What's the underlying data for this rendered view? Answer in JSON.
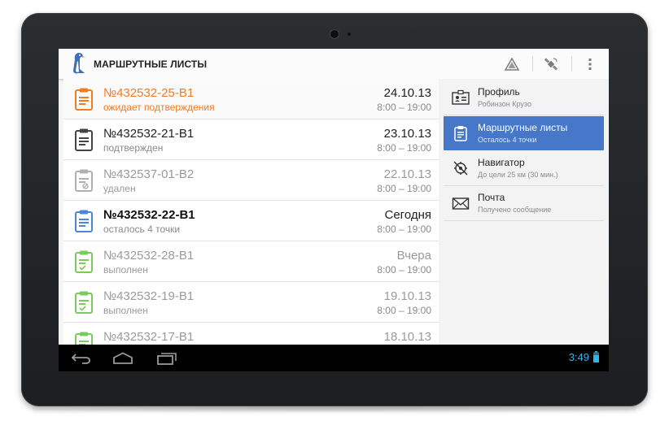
{
  "app": {
    "title": "МАРШРУТНЫЕ ЛИСТЫ",
    "logo_icon": "penguin-logo",
    "actions": [
      {
        "name": "warning-icon"
      },
      {
        "name": "gps-satellite-icon"
      },
      {
        "name": "overflow-menu-icon"
      }
    ]
  },
  "colors": {
    "orange": "#f47b20",
    "dark": "#444444",
    "gray": "#9a9a9a",
    "blue": "#4a86d4",
    "green": "#7cc95c",
    "accent": "#4677c9",
    "clock": "#33b5e5"
  },
  "routes": [
    {
      "number": "№432532-25-В1",
      "status": "ожидает подтверждения",
      "date": "24.10.13",
      "time": "8:00 – 19:00",
      "state": "pending"
    },
    {
      "number": "№432532-21-В1",
      "status": "подтвержден",
      "date": "23.10.13",
      "time": "8:00 – 19:00",
      "state": "confirmed"
    },
    {
      "number": "№432537-01-В2",
      "status": "удален",
      "date": "22.10.13",
      "time": "8:00 – 19:00",
      "state": "deleted"
    },
    {
      "number": "№432532-22-В1",
      "status": "осталось 4 точки",
      "date": "Сегодня",
      "time": "8:00 – 19:00",
      "state": "active"
    },
    {
      "number": "№432532-28-В1",
      "status": "выполнен",
      "date": "Вчера",
      "time": "8:00 – 19:00",
      "state": "done"
    },
    {
      "number": "№432532-19-В1",
      "status": "выполнен",
      "date": "19.10.13",
      "time": "8:00 – 19:00",
      "state": "done"
    },
    {
      "number": "№432532-17-В1",
      "status": "",
      "date": "18.10.13",
      "time": "",
      "state": "done"
    }
  ],
  "sidebar": {
    "items": [
      {
        "title": "Профиль",
        "subtitle": "Робинзон Крузо",
        "icon": "profile-card-icon",
        "active": false
      },
      {
        "title": "Маршрутные листы",
        "subtitle": "Осталось 4 точки",
        "icon": "clipboard-icon",
        "active": true
      },
      {
        "title": "Навигатор",
        "subtitle": "До цели 25 км (30 мин.)",
        "icon": "navigator-icon",
        "active": false
      },
      {
        "title": "Почта",
        "subtitle": "Получено сообщение",
        "icon": "mail-icon",
        "active": false
      }
    ]
  },
  "system": {
    "clock": "3:49",
    "nav": [
      {
        "name": "back-icon"
      },
      {
        "name": "home-icon"
      },
      {
        "name": "recent-apps-icon"
      }
    ],
    "battery_icon": "battery-icon"
  }
}
